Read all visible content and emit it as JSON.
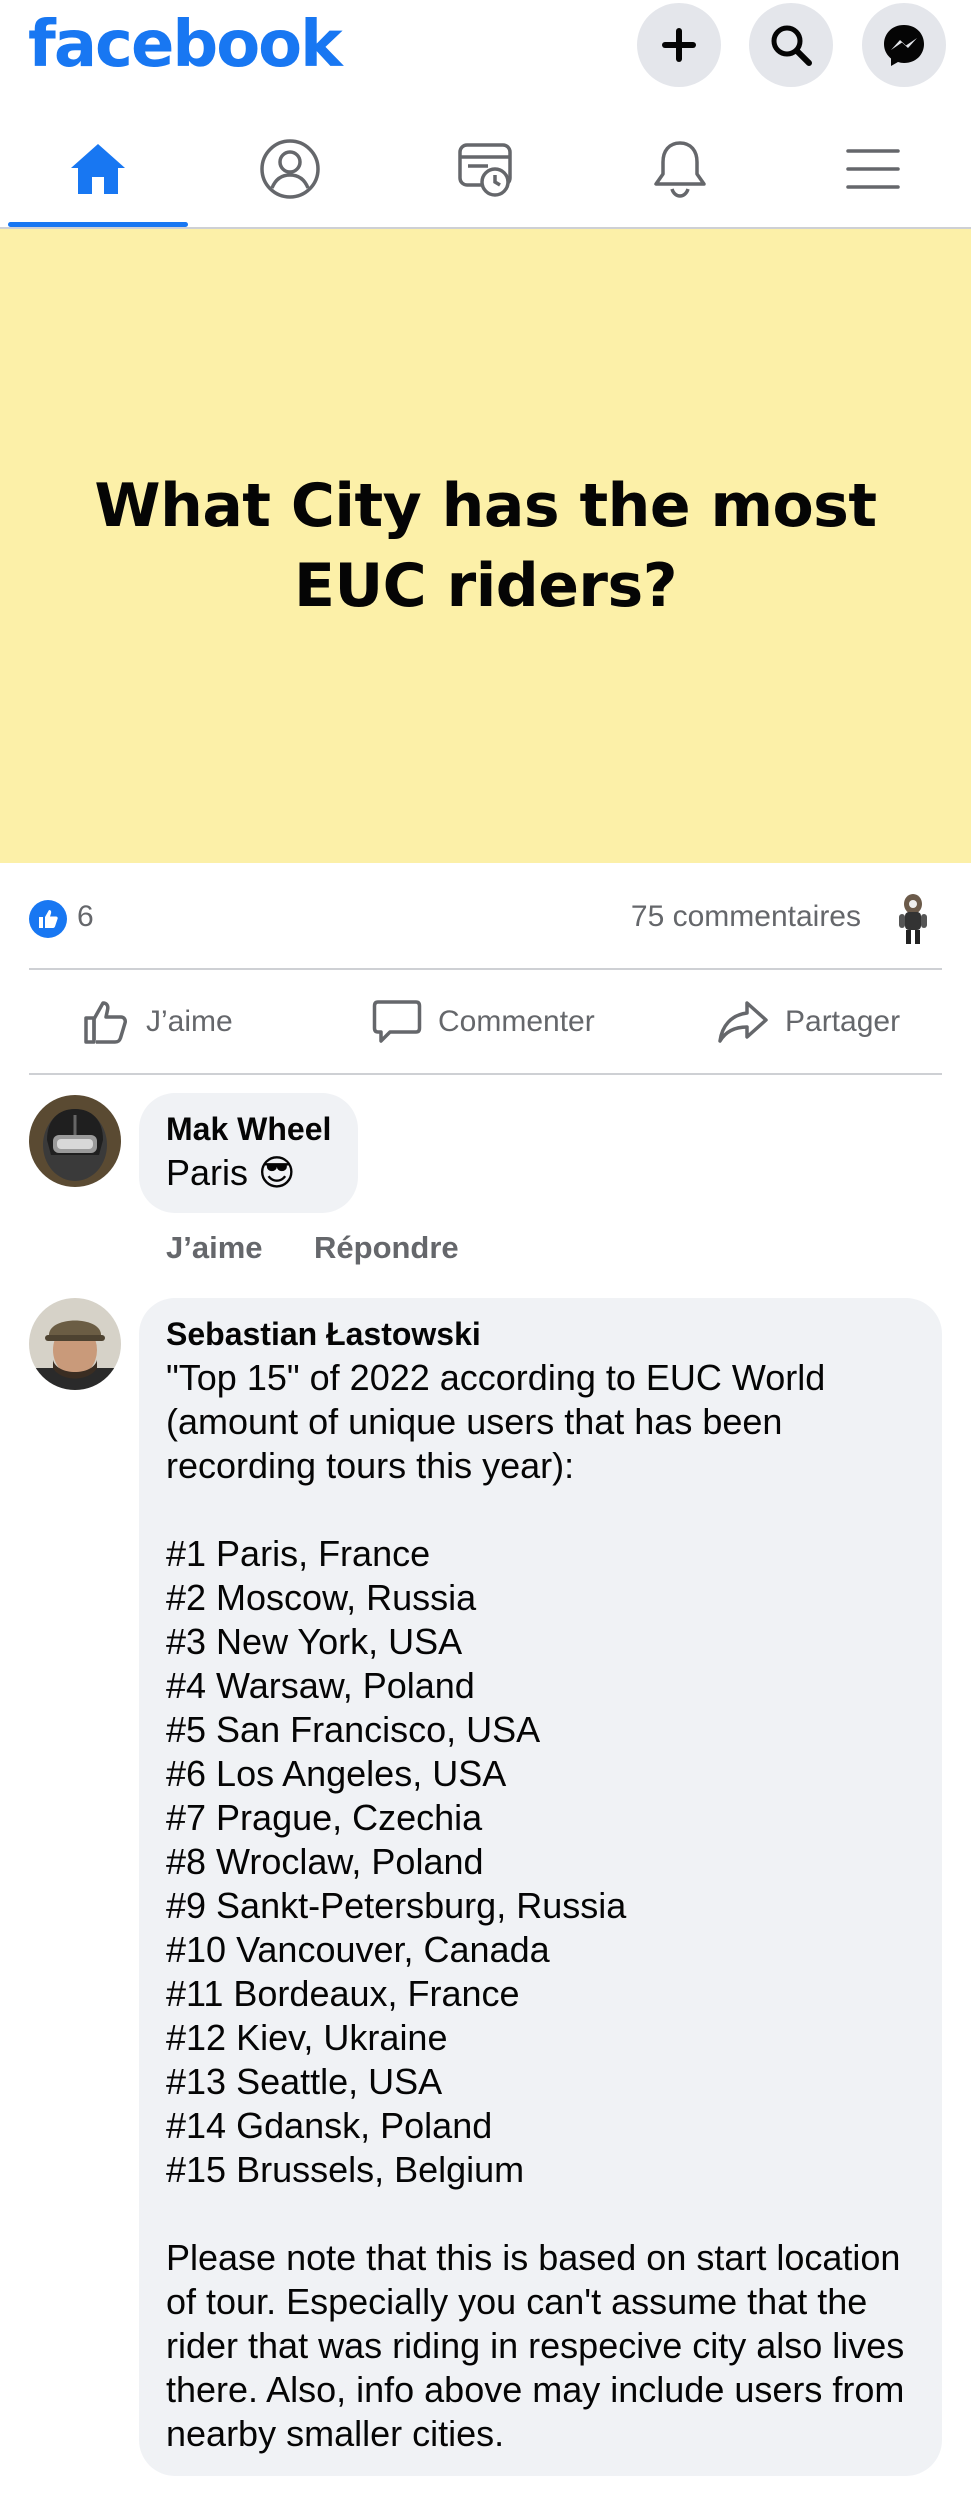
{
  "app": {
    "logo_text": "facebook",
    "brand_color": "#1877f2"
  },
  "topbar": {
    "icons": [
      "plus-icon",
      "search-icon",
      "messenger-icon"
    ]
  },
  "nav": {
    "tabs": [
      {
        "name": "home",
        "icon": "home-icon",
        "active": true
      },
      {
        "name": "profile",
        "icon": "profile-icon",
        "active": false
      },
      {
        "name": "memories",
        "icon": "memories-icon",
        "active": false
      },
      {
        "name": "notifications",
        "icon": "bell-icon",
        "active": false
      },
      {
        "name": "menu",
        "icon": "hamburger-menu-icon",
        "active": false
      }
    ]
  },
  "post": {
    "text": "What City has the most EUC riders?",
    "background_color": "#fcf0a8",
    "like_count": "6",
    "comments_count": "75 commentaires"
  },
  "actions": {
    "like": "J’aime",
    "comment": "Commenter",
    "share": "Partager"
  },
  "comments": [
    {
      "author": "Mak Wheel",
      "text": "Paris 😎",
      "like_label": "J’aime",
      "reply_label": "Répondre"
    },
    {
      "author": "Sebastian Łastowski",
      "text": "\"Top 15\" of 2022 according to EUC World (amount of unique users that has been recording tours this year):\n\n#1 Paris, France\n#2 Moscow, Russia\n#3 New York, USA\n#4 Warsaw, Poland\n#5 San Francisco, USA\n#6 Los Angeles, USA\n#7 Prague, Czechia\n#8 Wroclaw, Poland\n#9 Sankt-Petersburg, Russia\n#10 Vancouver, Canada\n#11 Bordeaux, France\n#12 Kiev, Ukraine\n#13 Seattle, USA\n#14 Gdansk, Poland\n#15 Brussels, Belgium\n\nPlease note that this is based on start location of tour. Especially you can't assume that the rider that was riding in respecive city also lives there. Also, info above may include users from nearby smaller cities."
    }
  ]
}
